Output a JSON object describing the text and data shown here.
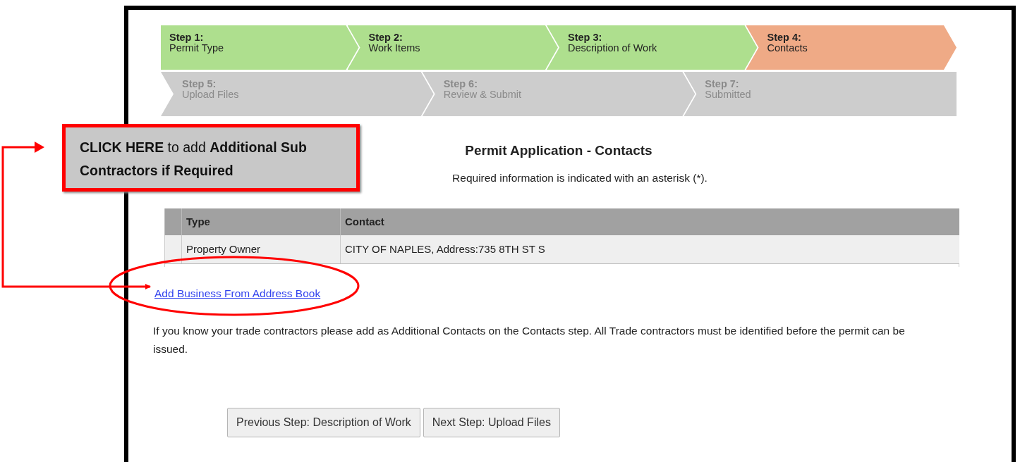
{
  "steps": [
    [
      {
        "number": "Step 1:",
        "label": "Permit Type",
        "completed": true,
        "selected": false
      },
      {
        "number": "Step 2:",
        "label": "Work Items",
        "completed": true,
        "selected": false
      },
      {
        "number": "Step 3:",
        "label": "Description of Work",
        "completed": true,
        "selected": false
      },
      {
        "number": "Step 4:",
        "label": "Contacts",
        "completed": false,
        "selected": true
      }
    ],
    [
      {
        "number": "Step 5:",
        "label": "Upload Files",
        "completed": false,
        "selected": false
      },
      {
        "number": "Step 6:",
        "label": "Review & Submit",
        "completed": false,
        "selected": false
      },
      {
        "number": "Step 7:",
        "label": "Submitted",
        "completed": false,
        "selected": false
      }
    ]
  ],
  "page_title": "Permit Application - Contacts",
  "required_note": "Required information is indicated with an asterisk (*).",
  "table": {
    "columns": [
      "Type",
      "Contact"
    ],
    "rows": [
      [
        "Property Owner",
        "CITY OF NAPLES, Address:735 8TH ST S"
      ]
    ]
  },
  "add_link": "Add Business From Address Book",
  "note": "If you know your trade contractors please add as Additional Contacts on the Contacts step. All Trade contractors must be identified before the permit can be issued.",
  "buttons": [
    "Previous Step: Description of Work",
    "Next Step: Upload Files"
  ],
  "callout": {
    "text": "**CLICK HERE** to add **Additional Sub Contractors if Required**"
  }
}
